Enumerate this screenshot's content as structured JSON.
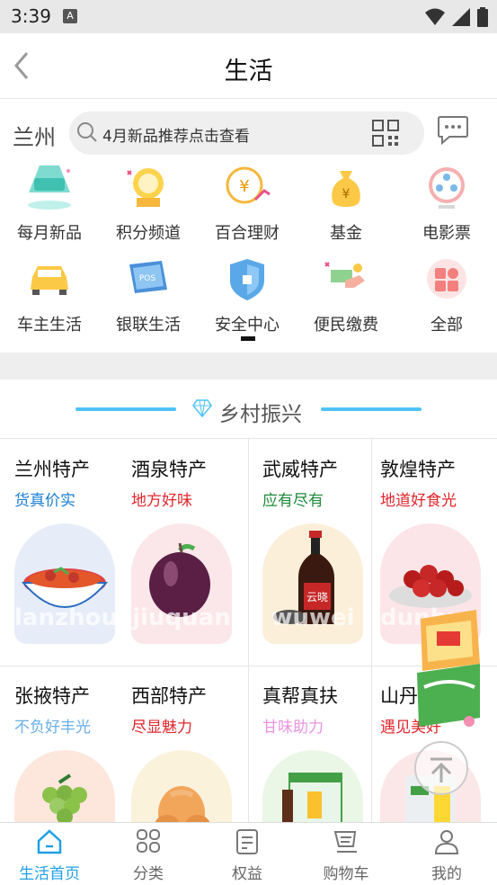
{
  "status_bar": {
    "time": "3:39",
    "notification_badge": "A"
  },
  "header": {
    "title": "生活"
  },
  "search": {
    "city": "兰州",
    "placeholder": "4月新品推荐点击查看"
  },
  "quick_links": [
    {
      "label": "每月新品",
      "icon": "new-badge-icon"
    },
    {
      "label": "积分频道",
      "icon": "points-coin-icon"
    },
    {
      "label": "百合理财",
      "icon": "finance-coin-icon"
    },
    {
      "label": "基金",
      "icon": "money-bag-icon"
    },
    {
      "label": "电影票",
      "icon": "film-reel-icon"
    },
    {
      "label": "车主生活",
      "icon": "car-icon"
    },
    {
      "label": "银联生活",
      "icon": "pos-card-icon"
    },
    {
      "label": "安全中心",
      "icon": "shield-icon"
    },
    {
      "label": "便民缴费",
      "icon": "payment-hand-icon"
    },
    {
      "label": "全部",
      "icon": "all-grid-icon"
    }
  ],
  "section": {
    "title": "乡村振兴"
  },
  "products": [
    {
      "title": "兰州特产",
      "subtitle": "货真价实",
      "subtitle_color": "#1a7fd6",
      "watermark": "lanzhou",
      "bg": "#e6edf8"
    },
    {
      "title": "酒泉特产",
      "subtitle": "地方好味",
      "subtitle_color": "#e0262b",
      "watermark": "jiuquan",
      "bg": "#fbe7ea"
    },
    {
      "title": "武威特产",
      "subtitle": "应有尽有",
      "subtitle_color": "#1d8a3a",
      "watermark": "wuwei",
      "bg": "#fbefd9"
    },
    {
      "title": "敦煌特产",
      "subtitle": "地道好食光",
      "subtitle_color": "#e0262b",
      "watermark": "dunhuang",
      "bg": "#fbe5e8"
    },
    {
      "title": "张掖特产",
      "subtitle": "不负好丰光",
      "subtitle_color": "#6aaee8",
      "watermark": "",
      "bg": "#fde6dc"
    },
    {
      "title": "西部特产",
      "subtitle": "尽显魅力",
      "subtitle_color": "#e0262b",
      "watermark": "",
      "bg": "#fbf2dc"
    },
    {
      "title": "真帮真扶",
      "subtitle": "甘味助力",
      "subtitle_color": "#e895e0",
      "watermark": "",
      "bg": "#eaf6e6"
    },
    {
      "title": "山丹特产",
      "subtitle": "遇见美好",
      "subtitle_color": "#e0262b",
      "watermark": "",
      "bg": "#fbe7e7"
    }
  ],
  "bottom_nav": [
    {
      "label": "生活首页",
      "active": true
    },
    {
      "label": "分类",
      "active": false
    },
    {
      "label": "权益",
      "active": false
    },
    {
      "label": "购物车",
      "active": false
    },
    {
      "label": "我的",
      "active": false
    }
  ],
  "colors": {
    "accent": "#1fa1e5",
    "section_line": "#4fc3f7"
  }
}
